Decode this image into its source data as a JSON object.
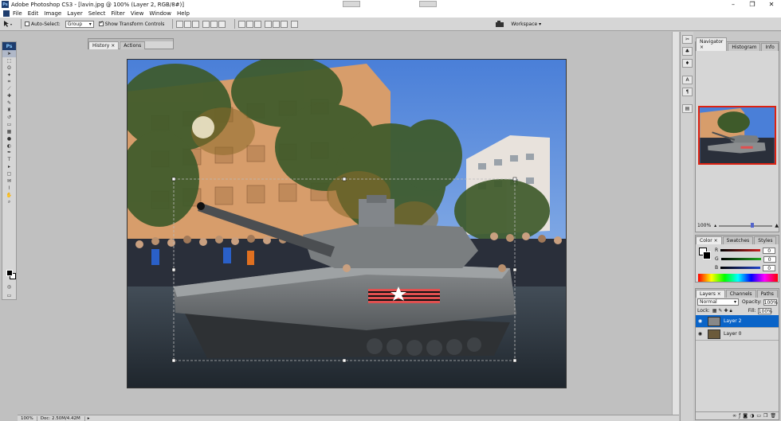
{
  "window": {
    "title": "Adobe Photoshop CS3 - [lavin.jpg @ 100% (Layer 2, RGB/8#)]",
    "app_short": "Ps"
  },
  "menu": [
    "File",
    "Edit",
    "Image",
    "Layer",
    "Select",
    "Filter",
    "View",
    "Window",
    "Help"
  ],
  "options_bar": {
    "auto_select_label": "Auto-Select:",
    "auto_select_value": "Group",
    "show_transform_label": "Show Transform Controls",
    "workspace_label": "Workspace ▾"
  },
  "history_panel": {
    "tabs": [
      "History ×",
      "Actions"
    ]
  },
  "navigator_panel": {
    "tabs": [
      "Navigator ×",
      "Histogram",
      "Info"
    ],
    "zoom": "100%"
  },
  "color_panel": {
    "tabs": [
      "Color ×",
      "Swatches",
      "Styles"
    ],
    "channels": [
      {
        "label": "R",
        "value": "0",
        "color": "#cc2222"
      },
      {
        "label": "G",
        "value": "0",
        "color": "#22aa22"
      },
      {
        "label": "B",
        "value": "0",
        "color": "#2244cc"
      }
    ]
  },
  "layers_panel": {
    "tabs": [
      "Layers ×",
      "Channels",
      "Paths"
    ],
    "blend_mode": "Normal",
    "opacity_label": "Opacity:",
    "opacity_value": "100%",
    "lock_label": "Lock:",
    "fill_label": "Fill:",
    "fill_value": "100%",
    "layers": [
      {
        "name": "Layer 2",
        "active": true
      },
      {
        "name": "Layer 0",
        "active": false
      }
    ]
  },
  "status_bar": {
    "zoom": "100%",
    "doc": "Doc: 2.50M/4.42M"
  },
  "colors": {
    "selection_blue": "#0a64c8",
    "ps_brand": "#1e3d6e"
  }
}
